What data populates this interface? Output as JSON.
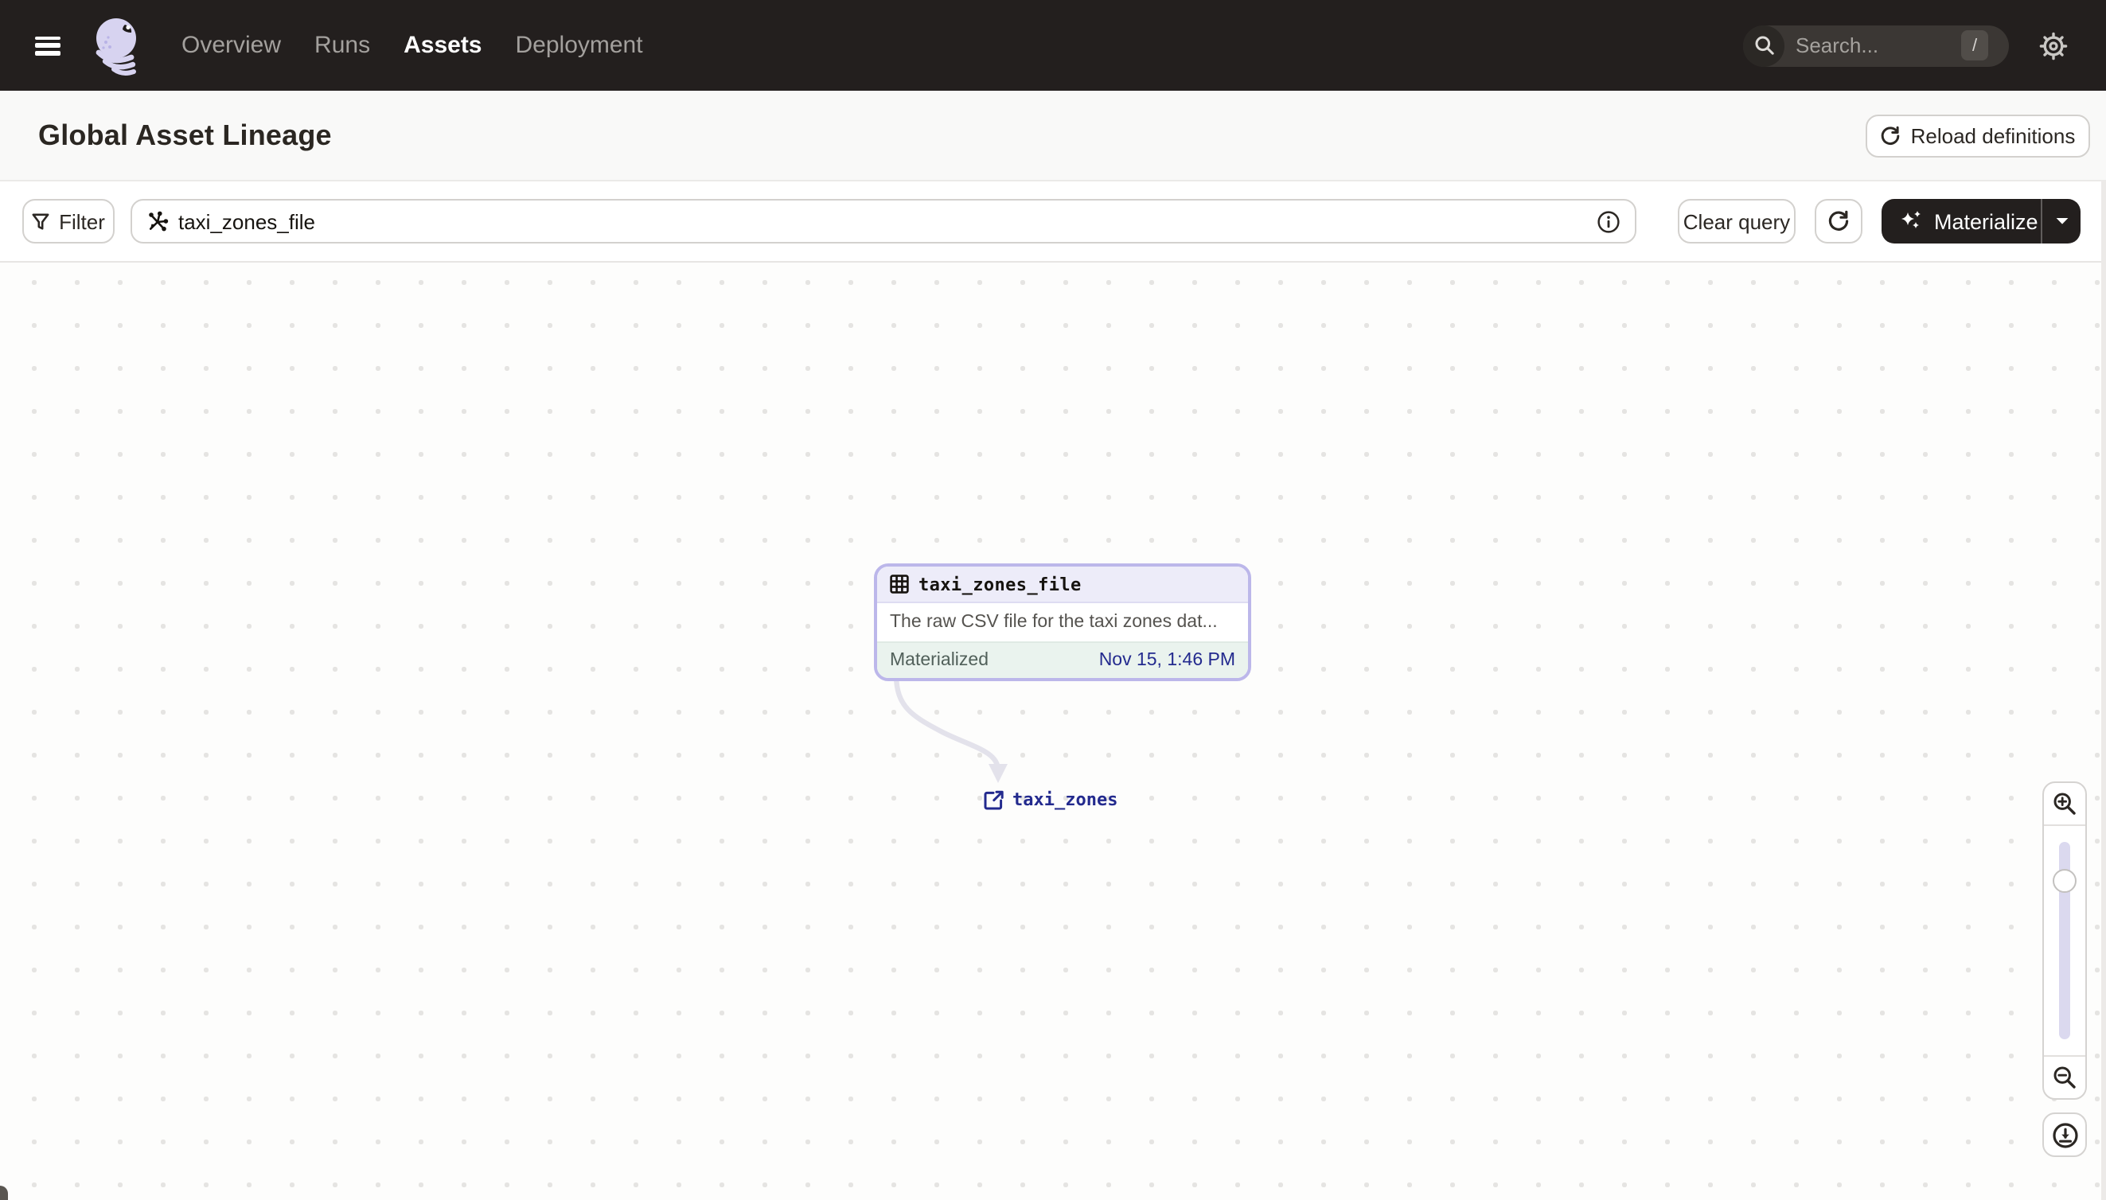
{
  "nav": {
    "items": [
      {
        "label": "Overview",
        "active": false
      },
      {
        "label": "Runs",
        "active": false
      },
      {
        "label": "Assets",
        "active": true
      },
      {
        "label": "Deployment",
        "active": false
      }
    ],
    "search": {
      "placeholder": "Search...",
      "shortcut_key": "/"
    },
    "icons": [
      "hamburger-icon",
      "dagster-logo",
      "search-icon",
      "gear-icon"
    ]
  },
  "header": {
    "title": "Global Asset Lineage",
    "reload_label": "Reload definitions",
    "reload_icon": "refresh-icon"
  },
  "toolbar": {
    "filter_label": "Filter",
    "filter_icon": "funnel-icon",
    "query_value": "taxi_zones_file",
    "query_icon": "op-selector-icon",
    "query_info_icon": "info-icon",
    "clear_label": "Clear query",
    "refresh_icon": "refresh-icon",
    "materialize_label": "Materialize",
    "materialize_icons": [
      "sparkles-icon",
      "caret-down-icon"
    ]
  },
  "graph": {
    "node": {
      "icon": "table-icon",
      "title": "taxi_zones_file",
      "description": "The raw CSV file for the taxi zones dat...",
      "status_label": "Materialized",
      "timestamp": "Nov 15, 1:46 PM"
    },
    "downstream_node": {
      "icon": "external-link-icon",
      "label": "taxi_zones"
    },
    "controls": [
      "zoom-in",
      "zoom-slider",
      "zoom-out",
      "download"
    ]
  },
  "colors": {
    "nav_bg": "#231f1e",
    "accent_lavender": "#bcb7ea",
    "node_header_bg": "#edecf9",
    "node_footer_bg": "#eaf3ee",
    "timestamp_blue": "#232a8e",
    "materialize_bg": "#231f1e",
    "logo_lavender": "#d7d3f0"
  }
}
